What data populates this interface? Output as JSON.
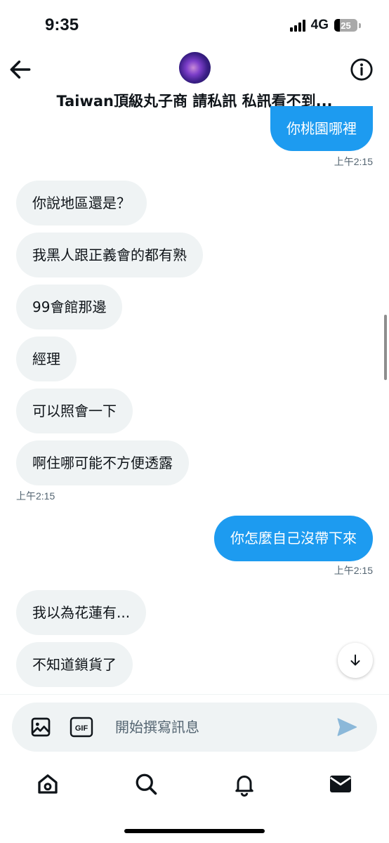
{
  "status_bar": {
    "time": "9:35",
    "network": "4G",
    "battery": "25"
  },
  "header": {
    "contact_name": "Taiwan頂級丸子商 請私訊 私訊看不到..."
  },
  "messages": [
    {
      "from": "out",
      "text": "你桃園哪裡"
    },
    {
      "from": "ts_out",
      "text": "上午2:15"
    },
    {
      "from": "in",
      "text": "你說地區還是？"
    },
    {
      "from": "in",
      "text": "我黑人跟正義會的都有熟"
    },
    {
      "from": "in",
      "text": "99會館那邊"
    },
    {
      "from": "in",
      "text": "經理"
    },
    {
      "from": "in",
      "text": "可以照會一下"
    },
    {
      "from": "in",
      "text": "啊住哪可能不方便透露"
    },
    {
      "from": "ts_in",
      "text": "上午2:15"
    },
    {
      "from": "out",
      "text": "你怎麼自己沒帶下來"
    },
    {
      "from": "ts_out",
      "text": "上午2:15"
    },
    {
      "from": "in",
      "text": "我以為花蓮有..."
    },
    {
      "from": "in",
      "text": "不知道鎖貨了"
    }
  ],
  "composer": {
    "placeholder": "開始撰寫訊息",
    "gif_label": "GIF"
  },
  "nav": [
    "home-icon",
    "search-icon",
    "bell-icon",
    "mail-icon"
  ],
  "colors": {
    "accent": "#1d9bf0",
    "incoming_bubble": "#eff3f4",
    "timestamp": "#536471"
  }
}
